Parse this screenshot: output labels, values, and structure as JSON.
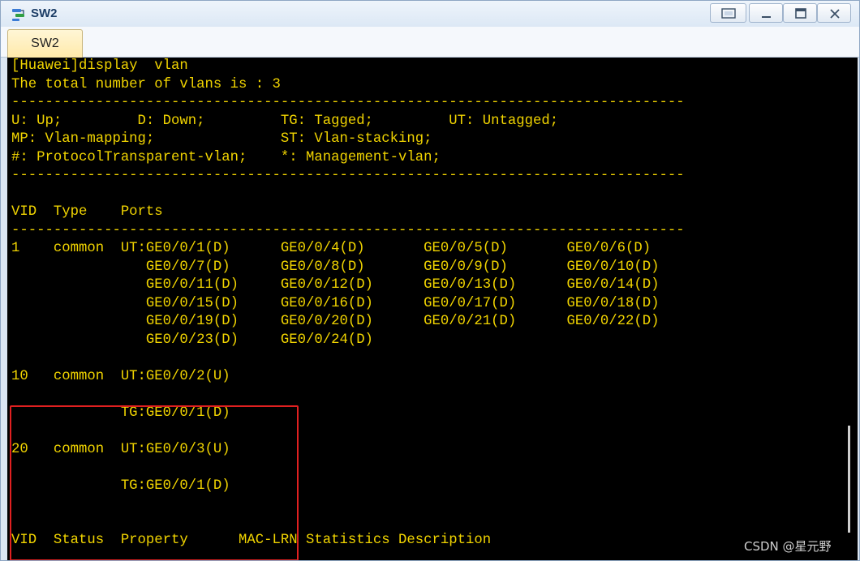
{
  "window": {
    "title": "SW2"
  },
  "tabs": [
    {
      "label": "SW2"
    }
  ],
  "terminal": {
    "lines": [
      "[Huawei]display  vlan",
      "The total number of vlans is : 3",
      "--------------------------------------------------------------------------------",
      "U: Up;         D: Down;         TG: Tagged;         UT: Untagged;",
      "MP: Vlan-mapping;               ST: Vlan-stacking;",
      "#: ProtocolTransparent-vlan;    *: Management-vlan;",
      "--------------------------------------------------------------------------------",
      "",
      "VID  Type    Ports",
      "--------------------------------------------------------------------------------",
      "1    common  UT:GE0/0/1(D)      GE0/0/4(D)       GE0/0/5(D)       GE0/0/6(D)",
      "                GE0/0/7(D)      GE0/0/8(D)       GE0/0/9(D)       GE0/0/10(D)",
      "                GE0/0/11(D)     GE0/0/12(D)      GE0/0/13(D)      GE0/0/14(D)",
      "                GE0/0/15(D)     GE0/0/16(D)      GE0/0/17(D)      GE0/0/18(D)",
      "                GE0/0/19(D)     GE0/0/20(D)      GE0/0/21(D)      GE0/0/22(D)",
      "                GE0/0/23(D)     GE0/0/24(D)",
      "",
      "10   common  UT:GE0/0/2(U)",
      "",
      "             TG:GE0/0/1(D)",
      "",
      "20   common  UT:GE0/0/3(U)",
      "",
      "             TG:GE0/0/1(D)",
      "",
      "",
      "VID  Status  Property      MAC-LRN Statistics Description"
    ]
  },
  "watermark": "CSDN @星元野",
  "colors": {
    "terminal_bg": "#000000",
    "terminal_text": "#f1d400",
    "highlight": "#e02020"
  },
  "icons": {
    "app": "switch-icon",
    "restore": "restore-icon",
    "minimize": "minimize-icon",
    "maximize": "maximize-icon",
    "close": "close-icon"
  }
}
